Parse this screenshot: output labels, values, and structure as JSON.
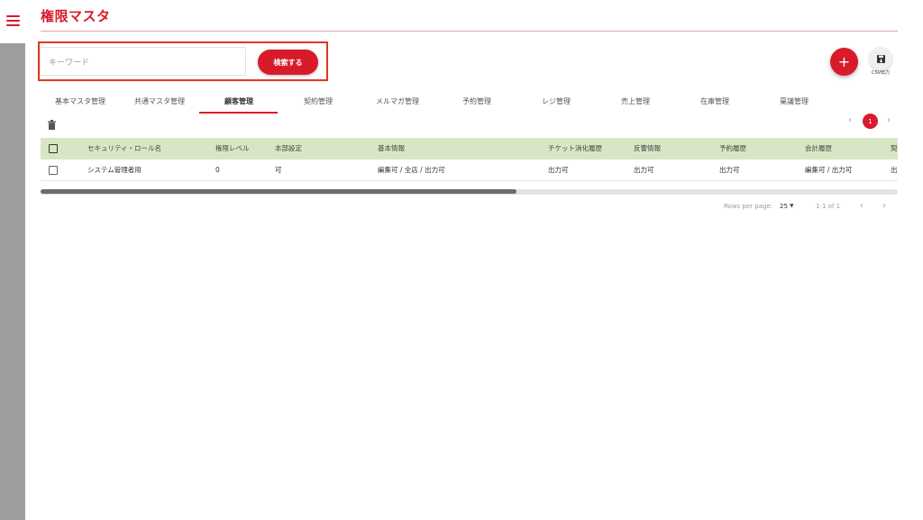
{
  "page": {
    "title": "権限マスタ"
  },
  "search": {
    "placeholder": "キーワード",
    "button_label": "検索する"
  },
  "actions": {
    "add_label": "+",
    "csv_label": "CSV出力"
  },
  "tabs": [
    {
      "label": "基本マスタ管理",
      "active": false
    },
    {
      "label": "共通マスタ管理",
      "active": false
    },
    {
      "label": "顧客管理",
      "active": true
    },
    {
      "label": "契約管理",
      "active": false
    },
    {
      "label": "メルマガ管理",
      "active": false
    },
    {
      "label": "予約管理",
      "active": false
    },
    {
      "label": "レジ管理",
      "active": false
    },
    {
      "label": "売上管理",
      "active": false
    },
    {
      "label": "在庫管理",
      "active": false
    },
    {
      "label": "稟議管理",
      "active": false
    }
  ],
  "pager_top": {
    "prev": "‹",
    "current": "1",
    "next": "›"
  },
  "table": {
    "headers": [
      "セキュリティ・ロール名",
      "権限レベル",
      "本部設定",
      "基本情報",
      "チケット消化履歴",
      "反響情報",
      "予約履歴",
      "会計履歴",
      "契"
    ],
    "rows": [
      [
        "システム管理者用",
        "0",
        "可",
        "編集可 / 全店 / 出力可",
        "出力可",
        "出力可",
        "出力可",
        "編集可 / 出力可",
        "出"
      ]
    ]
  },
  "footer": {
    "rows_per_page_label": "Rows per page:",
    "rows_per_page_value": "25",
    "range": "1-1 of 1",
    "prev": "‹",
    "next": "›"
  },
  "colors": {
    "accent": "#d81b2a",
    "header_bg": "#d9e6c5",
    "search_outline": "#e2361f",
    "rail": "#9e9e9e"
  }
}
